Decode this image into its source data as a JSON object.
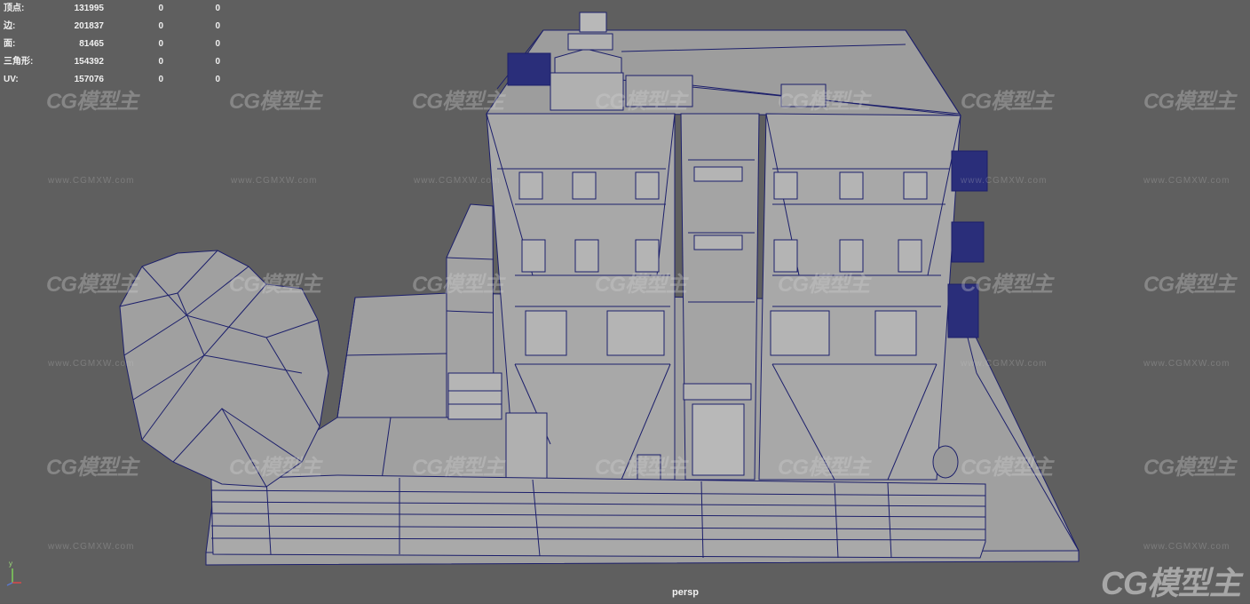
{
  "stats": {
    "rows": [
      {
        "label": "顶点:",
        "v1": "131995",
        "v2": "0",
        "v3": "0"
      },
      {
        "label": "边:",
        "v1": "201837",
        "v2": "0",
        "v3": "0"
      },
      {
        "label": "面:",
        "v1": "81465",
        "v2": "0",
        "v3": "0"
      },
      {
        "label": "三角形:",
        "v1": "154392",
        "v2": "0",
        "v3": "0"
      },
      {
        "label": "UV:",
        "v1": "157076",
        "v2": "0",
        "v3": "0"
      }
    ]
  },
  "watermark": {
    "logo": "CG模型主",
    "url": "www.CGMXW.com"
  },
  "camera": {
    "label": "persp"
  },
  "axis": {
    "y": "y"
  },
  "colors": {
    "background": "#5f5f5f",
    "wire": "#1c1f6b",
    "shade": "#9a9a9a"
  }
}
